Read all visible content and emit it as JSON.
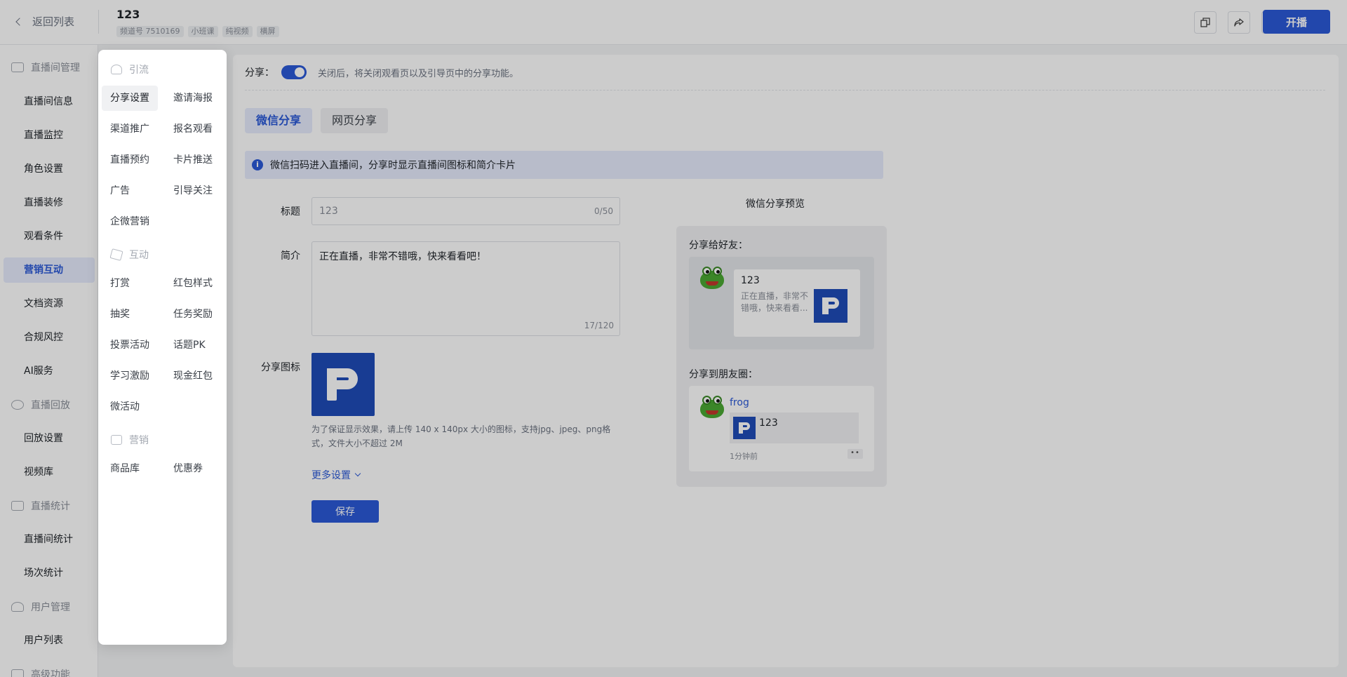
{
  "header": {
    "back_label": "返回列表",
    "room_title": "123",
    "tags": [
      "频道号 7510169",
      "小班课",
      "纯视频",
      "横屏"
    ],
    "live_button": "开播",
    "icons": [
      "copy-icon",
      "share-arrow-icon",
      "edit-icon"
    ]
  },
  "sidebar": {
    "groups": [
      {
        "label": "直播间管理",
        "icon": "monitor-icon",
        "items": [
          "直播间信息",
          "直播监控",
          "角色设置",
          "直播装修",
          "观看条件",
          "营销互动",
          "文档资源",
          "合规风控",
          "AI服务"
        ]
      },
      {
        "label": "直播回放",
        "icon": "replay-icon",
        "items": [
          "回放设置",
          "视频库"
        ]
      },
      {
        "label": "直播统计",
        "icon": "chart-icon",
        "items": [
          "直播间统计",
          "场次统计"
        ]
      },
      {
        "label": "用户管理",
        "icon": "user-icon",
        "items": [
          "用户列表"
        ]
      },
      {
        "label": "高级功能",
        "icon": "box-icon",
        "items": []
      }
    ],
    "active_item": "营销互动"
  },
  "popover": {
    "sections": [
      {
        "label": "引流",
        "icon": "users-icon",
        "items": [
          "分享设置",
          "邀请海报",
          "渠道推广",
          "报名观看",
          "直播预约",
          "卡片推送",
          "广告",
          "引导关注",
          "企微营销"
        ]
      },
      {
        "label": "互动",
        "icon": "star-icon",
        "items": [
          "打赏",
          "红包样式",
          "抽奖",
          "任务奖励",
          "投票活动",
          "话题PK",
          "学习激励",
          "现金红包",
          "微活动"
        ]
      },
      {
        "label": "营销",
        "icon": "bag-icon",
        "items": [
          "商品库",
          "优惠券"
        ]
      }
    ],
    "selected": "分享设置"
  },
  "main": {
    "share_label": "分享：",
    "share_enabled": true,
    "share_hint": "关闭后，将关闭观看页以及引导页中的分享功能。",
    "tabs": [
      {
        "label": "微信分享",
        "active": true
      },
      {
        "label": "网页分享",
        "active": false
      }
    ],
    "info_text": "微信扫码进入直播间，分享时显示直播间图标和简介卡片",
    "title_label": "标题",
    "title_value": "123",
    "title_count": "0/50",
    "desc_label": "简介",
    "desc_value": "正在直播，非常不错哦，快来看看吧！",
    "desc_count": "17/120",
    "icon_label": "分享图标",
    "icon_hint": "为了保证显示效果，请上传 140 x 140px 大小的图标，支持jpg、jpeg、png格式，文件大小不超过 2M",
    "more_settings": "更多设置",
    "save_button": "保存"
  },
  "preview": {
    "title": "微信分享预览",
    "friend_label": "分享给好友：",
    "friend_card_title": "123",
    "friend_card_desc": "正在直播，非常不错哦，快来看看...",
    "moment_label": "分享到朋友圈：",
    "moment_name": "frog",
    "moment_link_title": "123",
    "moment_time": "1分钟前",
    "moment_dots": "••"
  },
  "colors": {
    "primary": "#2b59d8",
    "logo_blue": "#1e4bb8",
    "active_bg": "#e6ecfd"
  }
}
